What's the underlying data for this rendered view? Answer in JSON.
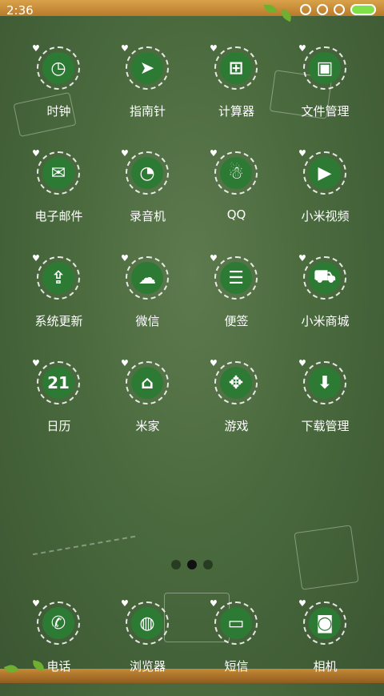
{
  "status_bar": {
    "time": "2:36"
  },
  "apps": [
    {
      "label": "时钟",
      "icon": "clock-icon",
      "glyph": "◷"
    },
    {
      "label": "指南针",
      "icon": "compass-icon",
      "glyph": "➤"
    },
    {
      "label": "计算器",
      "icon": "calculator-icon",
      "glyph": "⊞"
    },
    {
      "label": "文件管理",
      "icon": "briefcase-icon",
      "glyph": "▣"
    },
    {
      "label": "电子邮件",
      "icon": "mail-icon",
      "glyph": "✉"
    },
    {
      "label": "录音机",
      "icon": "recorder-icon",
      "glyph": "◔"
    },
    {
      "label": "QQ",
      "icon": "qq-penguin-icon",
      "glyph": "☃"
    },
    {
      "label": "小米视频",
      "icon": "video-icon",
      "glyph": "▶"
    },
    {
      "label": "系统更新",
      "icon": "system-update-icon",
      "glyph": "⇪"
    },
    {
      "label": "微信",
      "icon": "wechat-icon",
      "glyph": "☁"
    },
    {
      "label": "便签",
      "icon": "notes-icon",
      "glyph": "☰"
    },
    {
      "label": "小米商城",
      "icon": "shopping-cart-icon",
      "glyph": "⛟"
    },
    {
      "label": "日历",
      "icon": "calendar-icon",
      "glyph": "21"
    },
    {
      "label": "米家",
      "icon": "home-icon",
      "glyph": "⌂"
    },
    {
      "label": "游戏",
      "icon": "gamepad-icon",
      "glyph": "✥"
    },
    {
      "label": "下载管理",
      "icon": "download-icon",
      "glyph": "⬇"
    }
  ],
  "dock": [
    {
      "label": "电话",
      "icon": "phone-icon",
      "glyph": "✆"
    },
    {
      "label": "浏览器",
      "icon": "browser-icon",
      "glyph": "◍"
    },
    {
      "label": "短信",
      "icon": "message-icon",
      "glyph": "▭"
    },
    {
      "label": "相机",
      "icon": "camera-icon",
      "glyph": "◙"
    }
  ],
  "page_indicator": {
    "pages": 3,
    "current": 2
  }
}
